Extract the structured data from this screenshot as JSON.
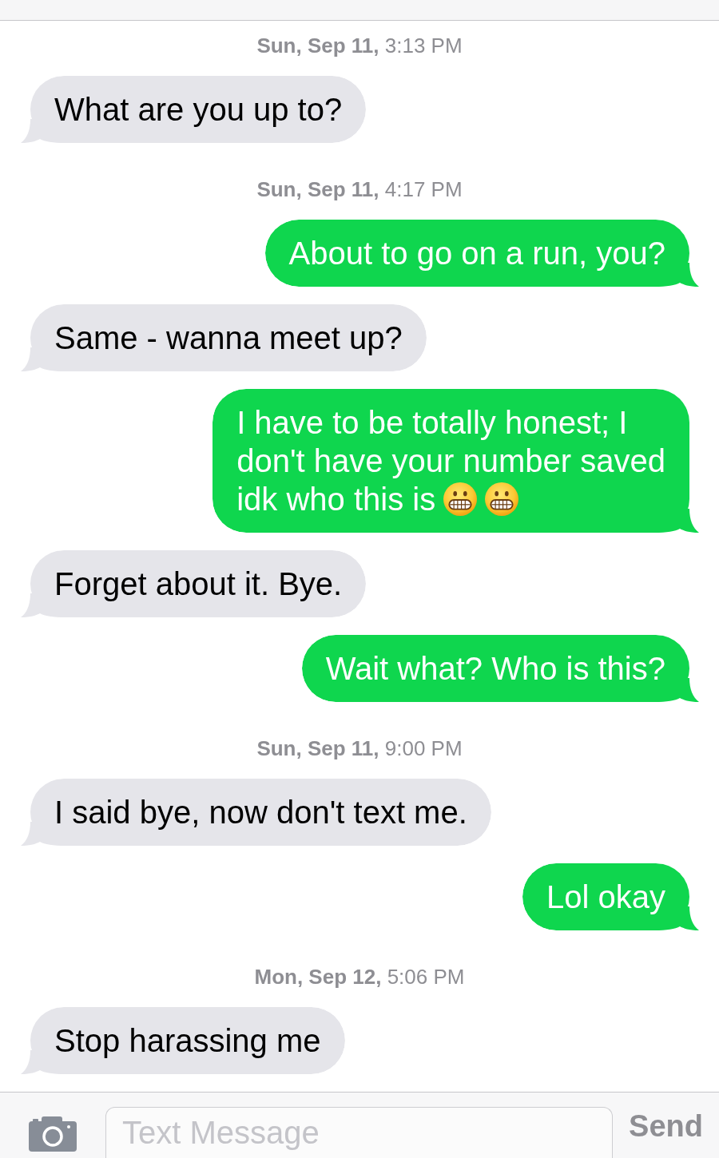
{
  "conversation": [
    {
      "kind": "timestamp",
      "text": "**Sun, Sep 11,** 3:13 PM"
    },
    {
      "kind": "received",
      "text": "What are you up to?"
    },
    {
      "kind": "timestamp",
      "text": "**Sun, Sep 11,** 4:17 PM"
    },
    {
      "kind": "sent",
      "text": "About to go on a run, you?"
    },
    {
      "kind": "received",
      "text": "Same - wanna meet up?"
    },
    {
      "kind": "sent",
      "lines": [
        "I have to be totally honest; I",
        "don't have your number saved",
        "idk who this is"
      ],
      "emojis": [
        {
          "kind": "grimacing"
        },
        {
          "kind": "grimacing"
        }
      ]
    },
    {
      "kind": "received",
      "text": "Forget about it. Bye."
    },
    {
      "kind": "sent",
      "text": "Wait what? Who is this?"
    },
    {
      "kind": "timestamp",
      "text": "**Sun, Sep 11,** 9:00 PM"
    },
    {
      "kind": "received",
      "text": "I said bye, now don't text me."
    },
    {
      "kind": "sent",
      "text": "Lol okay"
    },
    {
      "kind": "timestamp",
      "text": "**Mon, Sep 12,** 5:06 PM"
    },
    {
      "kind": "received",
      "text": "Stop harassing me"
    }
  ],
  "composer": {
    "placeholder": "Text Message",
    "send_label": "Send"
  }
}
